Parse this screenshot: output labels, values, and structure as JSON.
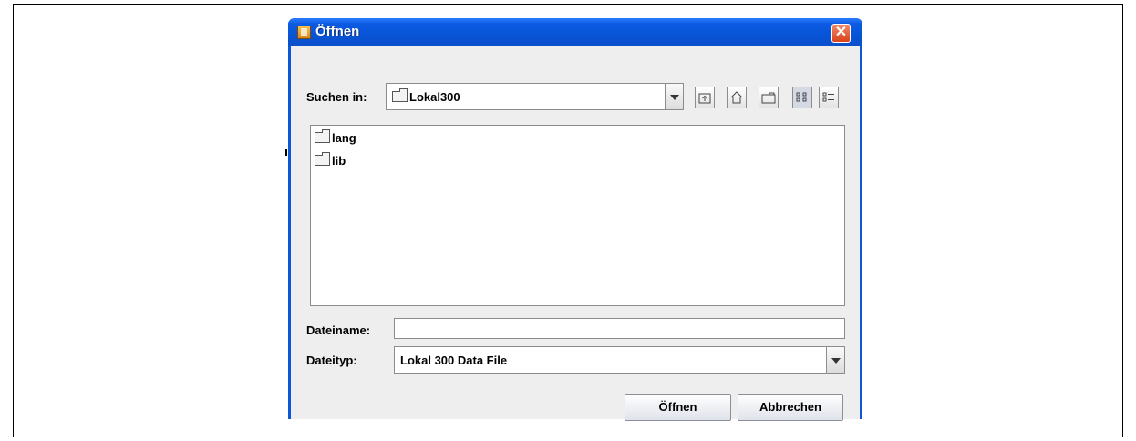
{
  "window": {
    "title": "Öffnen",
    "close_glyph": "✕"
  },
  "lookin": {
    "label": "Suchen in:",
    "value": "Lokal300"
  },
  "toolbar": {
    "up_icon": "up-folder-icon",
    "home_icon": "home-icon",
    "new_folder_icon": "new-folder-icon",
    "list_icon": "list-view-icon",
    "details_icon": "details-view-icon"
  },
  "files": [
    {
      "name": "lang",
      "icon": "folder-icon"
    },
    {
      "name": "lib",
      "icon": "folder-icon"
    }
  ],
  "filename": {
    "label": "Dateiname:",
    "value": ""
  },
  "filetype": {
    "label": "Dateityp:",
    "value": "Lokal 300 Data File"
  },
  "buttons": {
    "open": "Öffnen",
    "cancel": "Abbrechen"
  }
}
